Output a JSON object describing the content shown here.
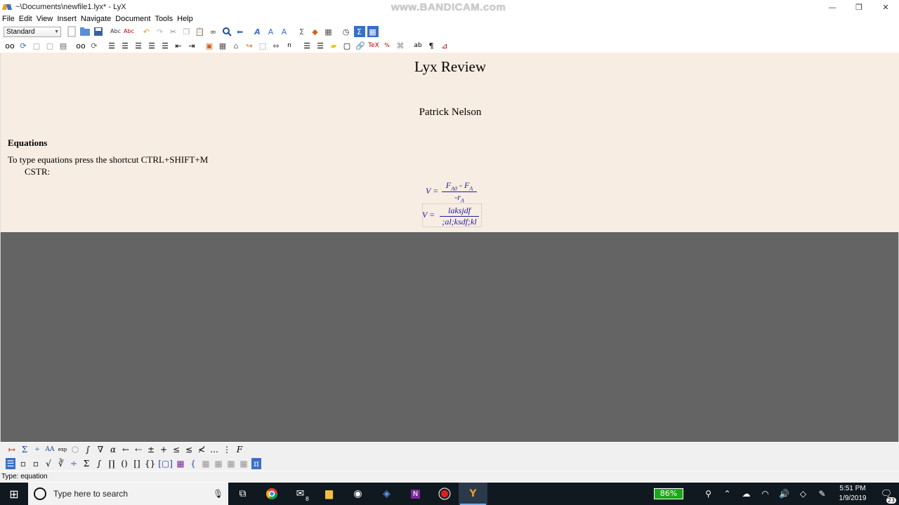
{
  "window": {
    "title": "~\\Documents\\newfile1.lyx* - LyX",
    "watermark": "www.BANDICAM.com",
    "minimize": "—",
    "restore": "❐",
    "close": "✕"
  },
  "menu": [
    "File",
    "Edit",
    "View",
    "Insert",
    "Navigate",
    "Document",
    "Tools",
    "Help"
  ],
  "toolbar": {
    "layout_value": "Standard"
  },
  "document": {
    "title": "Lyx Review",
    "author": "Patrick Nelson",
    "section": "Equations",
    "paragraph": "To type equations press the shortcut CTRL+SHIFT+M",
    "label": "CSTR:",
    "eq1": {
      "lhs": "V =",
      "num": "F_A0 - F_A",
      "den": "-r_A",
      "num_a": "F",
      "num_a_sub": "A0",
      "num_b": "F",
      "num_b_sub": "A",
      "den_a": "r",
      "den_a_sub": "A"
    },
    "eq2": {
      "lhs": "V =",
      "num": "laksjdf",
      "den": ";al;ksdf;kl"
    }
  },
  "status": {
    "text": "Type: equation"
  },
  "taskbar": {
    "search_placeholder": "Type here to search",
    "battery": "86%",
    "time": "5:51 PM",
    "date": "1/9/2019",
    "notifications": "23",
    "mail_badge": "8"
  }
}
